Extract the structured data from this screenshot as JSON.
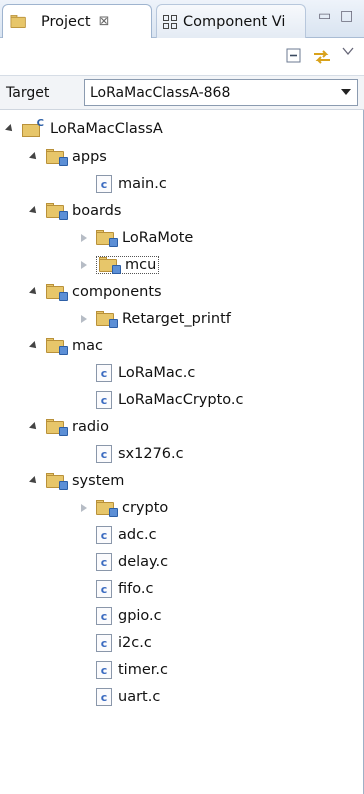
{
  "tabs": {
    "project": {
      "label": "Project",
      "close": "⊠"
    },
    "component": {
      "label": "Component Vi"
    }
  },
  "window_controls": {
    "minimize": "▭",
    "maximize": "□"
  },
  "toolbar": {
    "collapse_icon": "collapse-all-icon",
    "link_icon": "link-with-editor-icon",
    "menu_icon": "view-menu-icon"
  },
  "target": {
    "label": "Target",
    "value": "LoRaMacClassA-868"
  },
  "tree": {
    "root": "LoRaMacClassA",
    "apps": "apps",
    "main_c": "main.c",
    "boards": "boards",
    "loramote": "LoRaMote",
    "mcu": "mcu",
    "components": "components",
    "retarget": "Retarget_printf",
    "mac": "mac",
    "loramac_c": "LoRaMac.c",
    "loramaccrypto_c": "LoRaMacCrypto.c",
    "radio": "radio",
    "sx1276_c": "sx1276.c",
    "system": "system",
    "crypto": "crypto",
    "adc_c": "adc.c",
    "delay_c": "delay.c",
    "fifo_c": "fifo.c",
    "gpio_c": "gpio.c",
    "i2c_c": "i2c.c",
    "timer_c": "timer.c",
    "uart_c": "uart.c"
  },
  "file_badge": "c"
}
